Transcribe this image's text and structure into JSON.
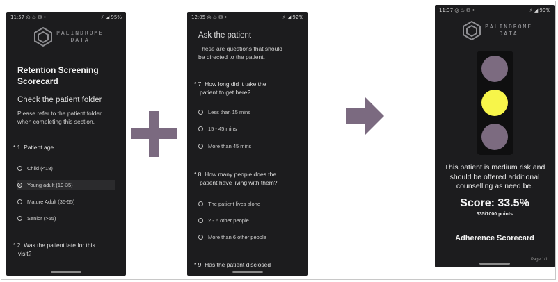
{
  "phone1": {
    "status": {
      "time": "11:57",
      "icons_left": "◎ ♨ ✉ •",
      "icons_right": "⚡ ◢ 95%"
    },
    "logo": {
      "line1": "PALINDROME",
      "line2": "DATA"
    },
    "title_line1": "Retention Screening",
    "title_line2": "Scorecard",
    "section": "Check the patient folder",
    "instructions_line1": "Please refer to the patient folder",
    "instructions_line2": "when completing this section.",
    "question1": "* 1. Patient age",
    "options": [
      "Child (<18)",
      "Young adult (19-35)",
      "Mature Adult (36-55)",
      "Senior (>55)"
    ],
    "selected_option": "Young adult (19-35)",
    "question2_line1": "* 2. Was the patient late for this",
    "question2_line2": "visit?"
  },
  "phone2": {
    "status": {
      "time": "12:05",
      "icons_left": "◎ ♨ ✉ •",
      "icons_right": "⚡ ◢ 92%"
    },
    "section": "Ask the patient",
    "intro_line1": "These are questions that should",
    "intro_line2": "be directed to the patient.",
    "question7_line1": "* 7. How long did it take the",
    "question7_line2": "patient to get here?",
    "options7": [
      "Less than 15 mins",
      "15 - 45 mins",
      "More than 45 mins"
    ],
    "question8_line1": "* 8. How many people does the",
    "question8_line2": "patient have living with them?",
    "options8": [
      "The patient lives alone",
      "2 - 6 other people",
      "More than 6 other people"
    ],
    "question9": "* 9. Has the patient disclosed"
  },
  "phone3": {
    "status": {
      "time": "11:37",
      "icons_left": "◎ ♨ ✉ •",
      "icons_right": "⚡ ◢ 99%"
    },
    "logo": {
      "line1": "PALINDROME",
      "line2": "DATA"
    },
    "traffic_light": {
      "top": "#7c6b80",
      "middle": "#f7f54a",
      "bottom": "#7c6b80",
      "active": "middle"
    },
    "result_line1": "This patient is medium risk and",
    "result_line2": "should be offered additional",
    "result_line3": "counselling as need be.",
    "score": "Score: 33.5%",
    "points": "335/1000 points",
    "next_section": "Adherence Scorecard",
    "peek": "Page 1/1"
  },
  "colors": {
    "symbol": "#7b6a80",
    "phone_bg": "#1c1c1e"
  }
}
